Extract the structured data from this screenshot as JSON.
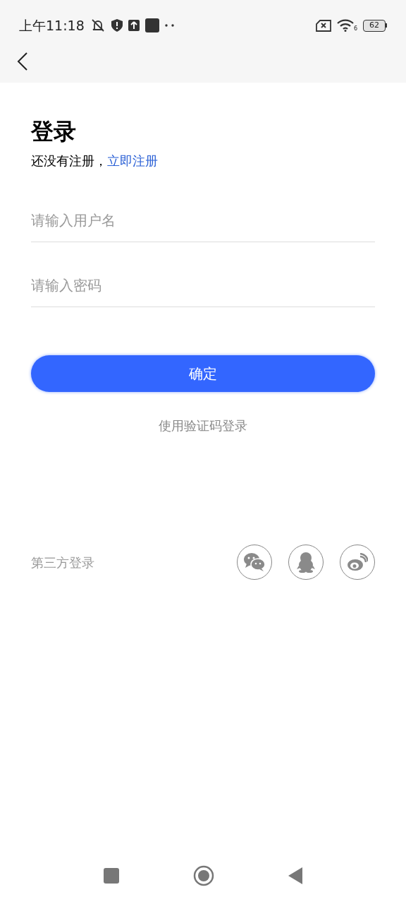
{
  "status_bar": {
    "time": "上午11:18",
    "wifi_badge": "6",
    "battery": "62"
  },
  "title": "登录",
  "register_prompt": {
    "text": "还没有注册，",
    "link": "立即注册"
  },
  "fields": [
    {
      "placeholder": "请输入用户名"
    },
    {
      "placeholder": "请输入密码"
    }
  ],
  "submit": "确定",
  "alt_login": "使用验证码登录",
  "third_party": {
    "label": "第三方登录",
    "providers": [
      {
        "kind": "chat"
      },
      {
        "kind": "penguin"
      },
      {
        "kind": "swirl"
      }
    ]
  }
}
